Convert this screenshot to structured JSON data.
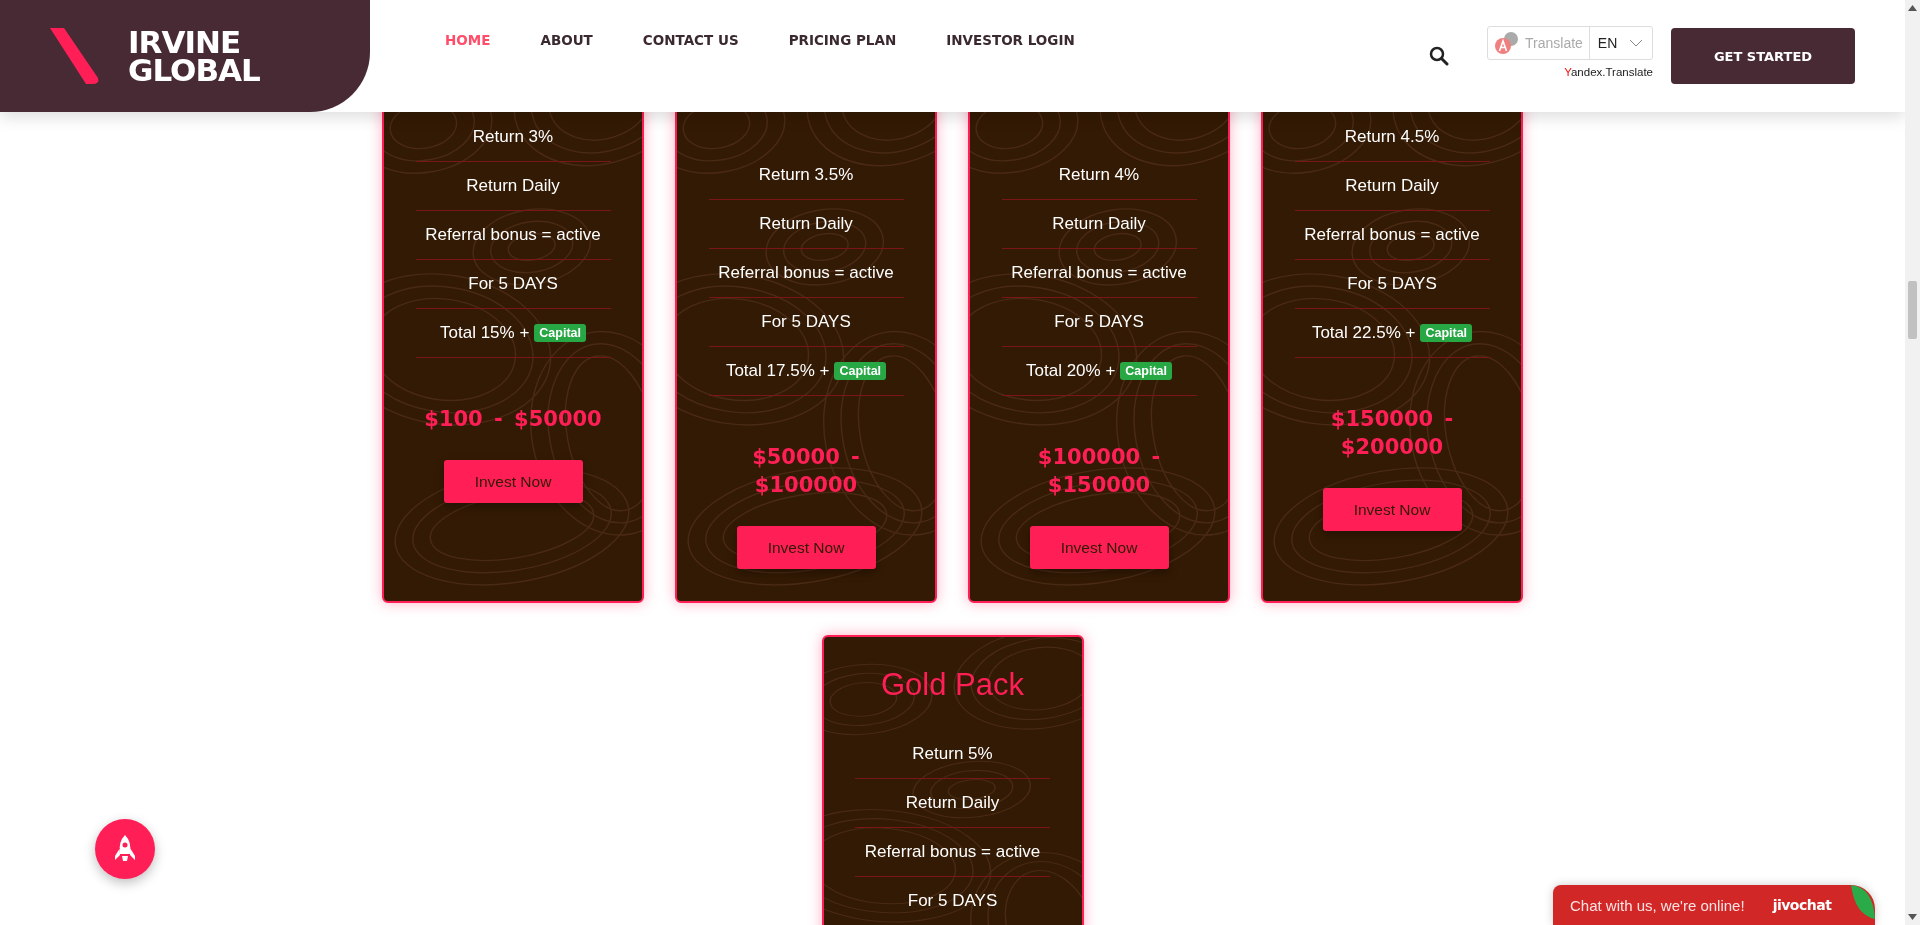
{
  "header": {
    "logo": {
      "line_1": "IRVINE",
      "line_2": "GLOBAL"
    },
    "nav": [
      {
        "label": "HOME",
        "selected": true
      },
      {
        "label": "ABOUT",
        "selected": false
      },
      {
        "label": "CONTACT US",
        "selected": false
      },
      {
        "label": "PRICING PLAN",
        "selected": false
      },
      {
        "label": "INVESTOR LOGIN",
        "selected": false
      }
    ],
    "translate": {
      "label": "Translate",
      "language": "EN",
      "credit": "Yandex.Translate"
    },
    "cta": "GET STARTED"
  },
  "plans": [
    {
      "features": [
        "Return 3%",
        "Return Daily",
        "Referral bonus = active",
        "For 5 DAYS"
      ],
      "total": "Total 15% +",
      "badge": "Capital",
      "price": "$100 - $50000",
      "button": "Invest Now"
    },
    {
      "features": [
        "Return 3.5%",
        "Return Daily",
        "Referral bonus = active",
        "For 5 DAYS"
      ],
      "total": "Total 17.5% +",
      "badge": "Capital",
      "price": "$50000 - $100000",
      "button": "Invest Now"
    },
    {
      "features": [
        "Return 4%",
        "Return Daily",
        "Referral bonus = active",
        "For 5 DAYS"
      ],
      "total": "Total 20% +",
      "badge": "Capital",
      "price": "$100000 - $150000",
      "button": "Invest Now"
    },
    {
      "features": [
        "Return 4.5%",
        "Return Daily",
        "Referral bonus = active",
        "For 5 DAYS"
      ],
      "total": "Total 22.5% +",
      "badge": "Capital",
      "price": "$150000 - $200000",
      "button": "Invest Now"
    },
    {
      "title": "Gold Pack",
      "features": [
        "Return 5%",
        "Return Daily",
        "Referral bonus = active",
        "For 5 DAYS"
      ]
    }
  ],
  "chat": {
    "message": "Chat with us, we're online!",
    "brand": "jivochat"
  }
}
